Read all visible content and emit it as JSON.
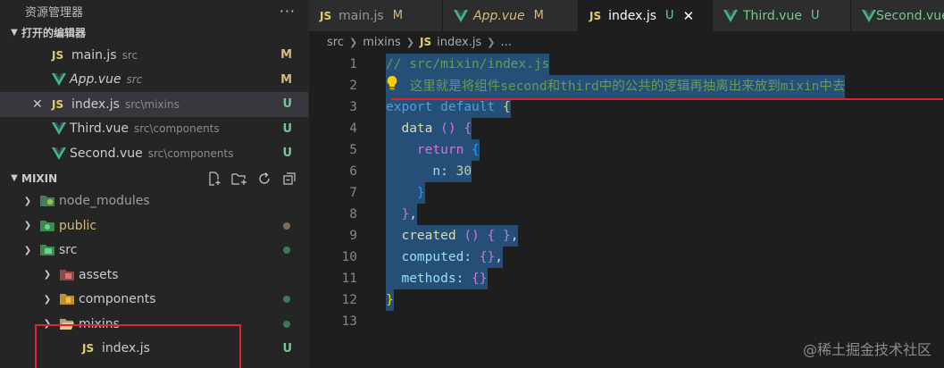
{
  "explorer": {
    "title": "资源管理器",
    "more": "···",
    "open_editors_label": "打开的编辑器",
    "open_editors": [
      {
        "lang": "JS",
        "name": "main.js",
        "desc": "src",
        "badge": "M"
      },
      {
        "lang": "vue",
        "name": "App.vue",
        "desc": "src",
        "badge": "M"
      },
      {
        "lang": "JS",
        "name": "index.js",
        "desc": "src\\mixins",
        "badge": "U",
        "close": "✕"
      },
      {
        "lang": "vue",
        "name": "Third.vue",
        "desc": "src\\components",
        "badge": "U"
      },
      {
        "lang": "vue",
        "name": "Second.vue",
        "desc": "src\\components",
        "badge": "U"
      }
    ],
    "project_label": "MIXIN",
    "tree": [
      {
        "name": "node_modules"
      },
      {
        "name": "public"
      },
      {
        "name": "src"
      },
      {
        "name": "assets"
      },
      {
        "name": "components"
      },
      {
        "name": "mixins"
      },
      {
        "lang": "JS",
        "name": "index.js",
        "badge": "U"
      }
    ]
  },
  "tabs": [
    {
      "lang": "JS",
      "name": "main.js",
      "badge": "M"
    },
    {
      "lang": "vue",
      "name": "App.vue",
      "badge": "M"
    },
    {
      "lang": "JS",
      "name": "index.js",
      "badge": "U",
      "close": "✕"
    },
    {
      "lang": "vue",
      "name": "Third.vue",
      "badge": "U"
    },
    {
      "lang": "vue",
      "name": "Second.vue"
    }
  ],
  "breadcrumb": {
    "p1": "src",
    "p2": "mixins",
    "lang": "JS",
    "p3": "index.js",
    "p4": "..."
  },
  "editor": {
    "line_numbers": [
      "1",
      "2",
      "3",
      "4",
      "5",
      "6",
      "7",
      "8",
      "9",
      "10",
      "11",
      "12",
      "13"
    ],
    "line1": "// src/mixin/index.js",
    "line2_comment": " 这里就是将组件second和third中的公共的逻辑再抽离出来放到mixin中去",
    "kw_export": "export",
    "kw_default": "default",
    "kw_return": "return",
    "prop_data": "data",
    "prop_n": "n",
    "num_30": "30",
    "prop_created": "created",
    "prop_computed": "computed",
    "prop_methods": "methods"
  },
  "watermark": "@稀土掘金技术社区"
}
